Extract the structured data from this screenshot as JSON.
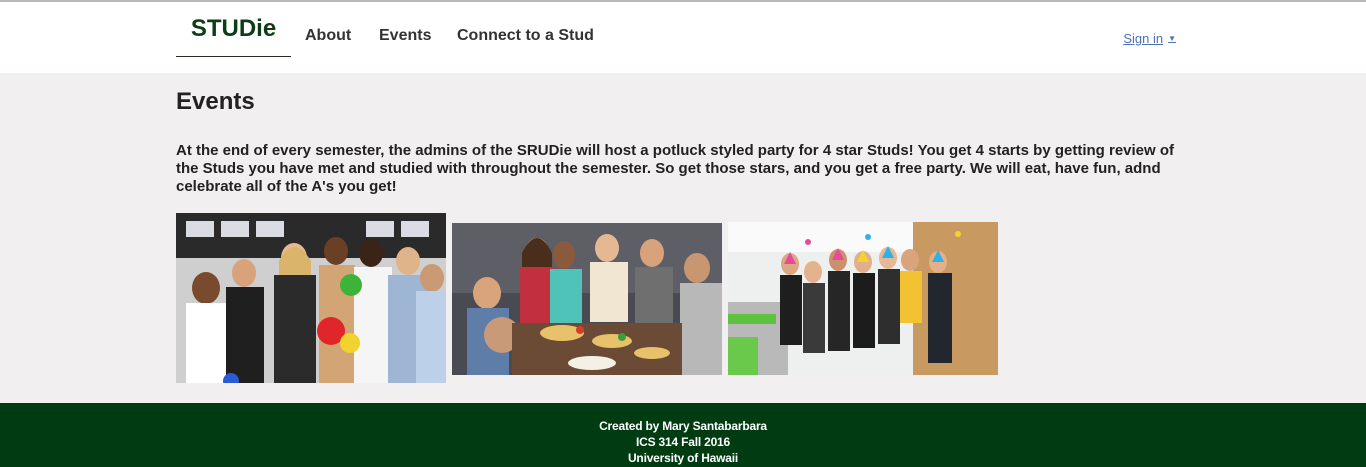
{
  "navbar": {
    "brand": "STUDie",
    "items": [
      {
        "label": "About"
      },
      {
        "label": "Events"
      },
      {
        "label": "Connect to a Stud"
      }
    ],
    "signin": "Sign in",
    "signin_caret_icon": "caret-down-icon"
  },
  "main": {
    "title": "Events",
    "description": "At the end of every semester, the admins of the SRUDie will host a potluck styled party for 4 star Studs! You get 4 starts by getting review of the Studs you have met and studied with throughout the semester. So get those stars, and you get a free party. We will eat, have fun, adnd celebrate all of the A's you get!"
  },
  "footer": {
    "line1": "Created by Mary Santabarbara",
    "line2": "ICS 314 Fall 2016",
    "line3": "University of Hawaii"
  },
  "colors": {
    "brand": "#0d3d17",
    "footer_bg": "#013b12",
    "page_bg": "#f1efef",
    "link": "#4a72b0"
  }
}
